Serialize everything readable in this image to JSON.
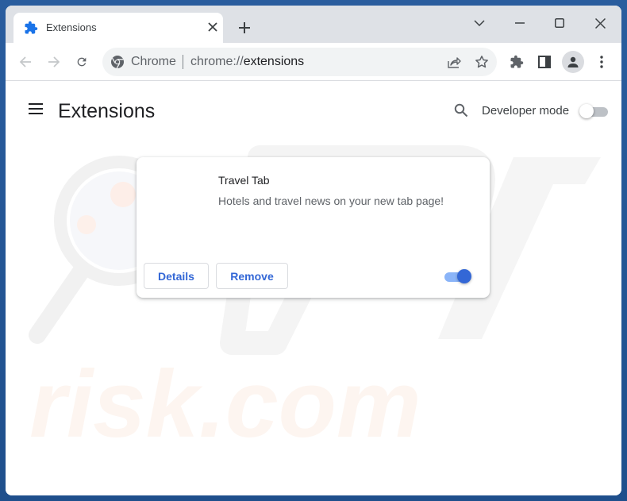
{
  "window": {
    "tab": {
      "title": "Extensions",
      "icon": "puzzle-icon"
    },
    "controls": {
      "tab_search": "chevron-down-icon",
      "minimize": "minimize-icon",
      "maximize": "maximize-icon",
      "close": "close-icon"
    }
  },
  "toolbar": {
    "omnibox": {
      "site_label": "Chrome",
      "url_scheme": "chrome://",
      "url_path": "extensions"
    }
  },
  "page": {
    "title": "Extensions",
    "developer_mode": {
      "label": "Developer mode",
      "enabled": false
    }
  },
  "extensions": [
    {
      "name": "Travel Tab",
      "description": "Hotels and travel news on your new tab page!",
      "details_label": "Details",
      "remove_label": "Remove",
      "enabled": true
    }
  ],
  "colors": {
    "accent": "#3367d6",
    "toggle_on_track": "#8ab4f8",
    "titlebar": "#dee1e6",
    "desktop": "#2a5d9e"
  },
  "watermark": {
    "text": "risk.com"
  }
}
